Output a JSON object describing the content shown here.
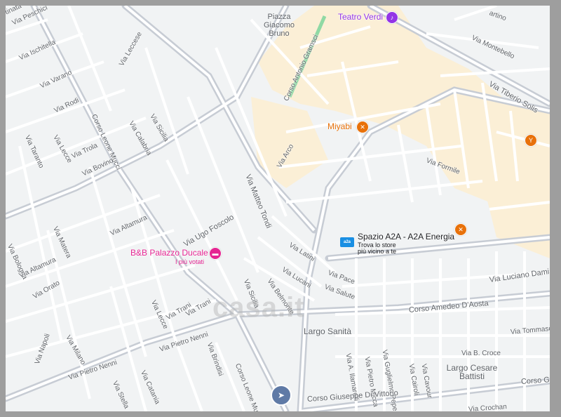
{
  "map": {
    "colors": {
      "background": "#f1f3f4",
      "road": "#ffffff",
      "major_road": "#c7ccd4",
      "district": "#fbefd6",
      "green": "#8fd9a4"
    },
    "places": [
      {
        "id": "piazza",
        "text": "Piazza Giacomo Bruno"
      },
      {
        "id": "largo-sanita",
        "text": "Largo Sanità"
      },
      {
        "id": "largo-battisti",
        "text": "Largo Cesare Battisti"
      }
    ],
    "streets": [
      "Via Peschici",
      "Via Ischitella",
      "Via Varano",
      "Via Rodi",
      "Via Lecce",
      "Via Taranto",
      "Via Leccese",
      "Corso Leone Mucci",
      "Via Trola",
      "Via Bovino",
      "Via Calabria",
      "Via Sicilia",
      "Corso Antonio Gramsci",
      "Via Arco",
      "Via Matteo Tondi",
      "Via Ugo Foscolo",
      "Via Altamura",
      "Via Bologna",
      "Via Matera",
      "Via Altamura",
      "Via Orato",
      "Via Lecce",
      "Via Milano",
      "Via Trani",
      "Via Pietro Nenni",
      "Via Napoli",
      "Via Pietro Nenni",
      "Via Stella",
      "Via Catania",
      "Via Brindisi",
      "Corso Leone Mucci",
      "Via Sicilia",
      "Via Belmonte",
      "Via Lucani",
      "Via Latini",
      "Via Pace",
      "Via Salute",
      "Via Trani",
      "Via Montebello",
      "Via Tiberio Solis",
      "Via Formile",
      "Via Luciano Damiani",
      "Corso Amedeo D'Aosta",
      "Via Tommaso",
      "Via A. Ilamarelli",
      "Via Pietro Micca",
      "Via Guglielmo Pepe",
      "Via Cairoli",
      "Via Cavour",
      "Via B. Croce",
      "Corso Giuseppe Di Vittorio",
      "Corso Gius",
      "Via Crochan",
      "artino",
      "tinata"
    ],
    "pois": [
      {
        "id": "teatro",
        "name": "Teatro Verdi",
        "color": "#9334e6",
        "icon": "theater-icon"
      },
      {
        "id": "miyabi",
        "name": "Miyabi",
        "color": "#e8710a",
        "icon": "restaurant-icon"
      },
      {
        "id": "bar",
        "name": "",
        "color": "#e8710a",
        "icon": "bar-icon"
      },
      {
        "id": "restaurant2",
        "name": "",
        "color": "#e8710a",
        "icon": "restaurant-icon"
      },
      {
        "id": "bnb",
        "name": "B&B Palazzo Ducale",
        "sub": "I più votati",
        "color": "#e52592",
        "icon": "hotel-icon"
      }
    ],
    "a2a": {
      "name": "Spazio A2A - A2A Energia",
      "desc_line1": "Trova lo store",
      "desc_line2": "più vicino a te",
      "logo": "a2a"
    },
    "watermark": "casa.it",
    "nav_icon": "navigation-arrow-icon"
  }
}
